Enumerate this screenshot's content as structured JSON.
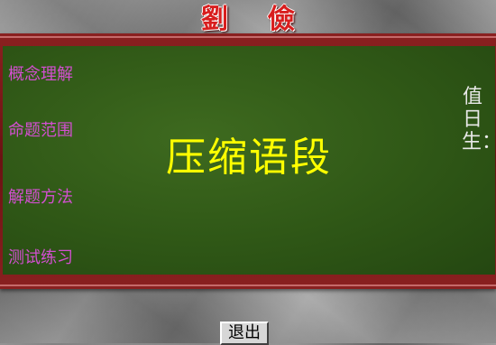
{
  "header": {
    "title": "劉儉"
  },
  "menu": {
    "items": [
      {
        "label": "概念理解"
      },
      {
        "label": "命题范围"
      },
      {
        "label": "解题方法"
      },
      {
        "label": "测试练习"
      }
    ]
  },
  "board": {
    "title": "压缩语段",
    "duty_label": "值日生："
  },
  "footer": {
    "exit_label": "退出"
  },
  "colors": {
    "board_green": "#2f5716",
    "frame_red": "#6b1212",
    "title_yellow": "#ffff00",
    "menu_magenta": "#d24fd0",
    "header_red": "#d81e1e"
  }
}
